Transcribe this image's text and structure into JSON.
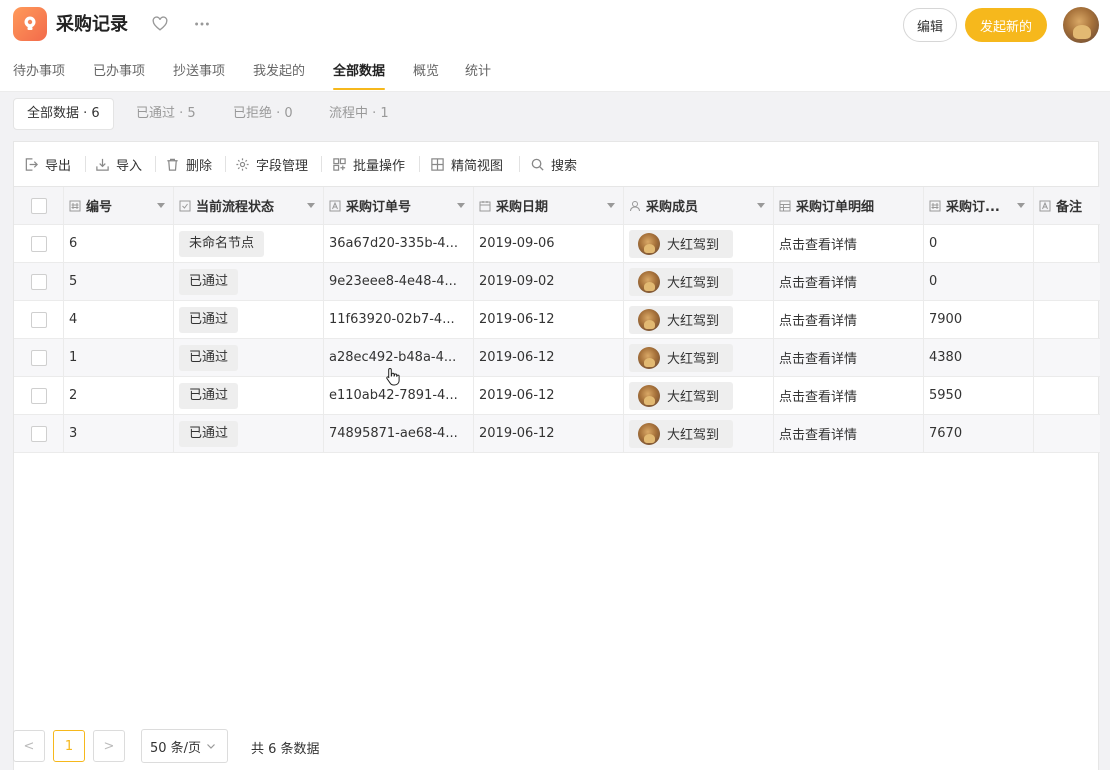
{
  "app": {
    "title": "采购记录"
  },
  "header": {
    "edit_label": "编辑",
    "new_label": "发起新的"
  },
  "nav": {
    "tabs": [
      {
        "label": "待办事项"
      },
      {
        "label": "已办事项"
      },
      {
        "label": "抄送事项"
      },
      {
        "label": "我发起的"
      },
      {
        "label": "全部数据",
        "active": true
      },
      {
        "label": "概览"
      },
      {
        "label": "统计"
      }
    ]
  },
  "filters": [
    {
      "label": "全部数据 · 6",
      "active": true
    },
    {
      "label": "已通过 · 5"
    },
    {
      "label": "已拒绝 · 0"
    },
    {
      "label": "流程中 · 1"
    }
  ],
  "toolbar": {
    "export": "导出",
    "import": "导入",
    "delete": "删除",
    "fields": "字段管理",
    "batch": "批量操作",
    "compact": "精简视图",
    "search": "搜索"
  },
  "table": {
    "columns": {
      "id": "编号",
      "status": "当前流程状态",
      "order_no": "采购订单号",
      "date": "采购日期",
      "member": "采购成员",
      "detail": "采购订单明细",
      "amount": "采购订...",
      "note": "备注"
    },
    "rows": [
      {
        "id": "6",
        "status": "未命名节点",
        "order_no": "36a67d20-335b-4...",
        "date": "2019-09-06",
        "member": "大红驾到",
        "detail": "点击查看详情",
        "amount": "0",
        "note": ""
      },
      {
        "id": "5",
        "status": "已通过",
        "order_no": "9e23eee8-4e48-4...",
        "date": "2019-09-02",
        "member": "大红驾到",
        "detail": "点击查看详情",
        "amount": "0",
        "note": ""
      },
      {
        "id": "4",
        "status": "已通过",
        "order_no": "11f63920-02b7-4...",
        "date": "2019-06-12",
        "member": "大红驾到",
        "detail": "点击查看详情",
        "amount": "7900",
        "note": ""
      },
      {
        "id": "1",
        "status": "已通过",
        "order_no": "a28ec492-b48a-4...",
        "date": "2019-06-12",
        "member": "大红驾到",
        "detail": "点击查看详情",
        "amount": "4380",
        "note": ""
      },
      {
        "id": "2",
        "status": "已通过",
        "order_no": "e110ab42-7891-4...",
        "date": "2019-06-12",
        "member": "大红驾到",
        "detail": "点击查看详情",
        "amount": "5950",
        "note": ""
      },
      {
        "id": "3",
        "status": "已通过",
        "order_no": "74895871-ae68-4...",
        "date": "2019-06-12",
        "member": "大红驾到",
        "detail": "点击查看详情",
        "amount": "7670",
        "note": ""
      }
    ]
  },
  "pagination": {
    "prev": "<",
    "current_page": "1",
    "next": ">",
    "page_size": "50 条/页",
    "total": "共 6 条数据"
  },
  "colors": {
    "accent": "#f6b81c",
    "app_icon": "#f26a4b"
  },
  "icons": {
    "app": "lightbulb-icon",
    "favorite": "heart-outline-icon",
    "more": "ellipsis-icon",
    "export": "export-icon",
    "import": "import-icon",
    "delete": "trash-icon",
    "fields": "gear-icon",
    "batch": "grid-plus-icon",
    "compact": "grid-icon",
    "search": "search-icon"
  }
}
